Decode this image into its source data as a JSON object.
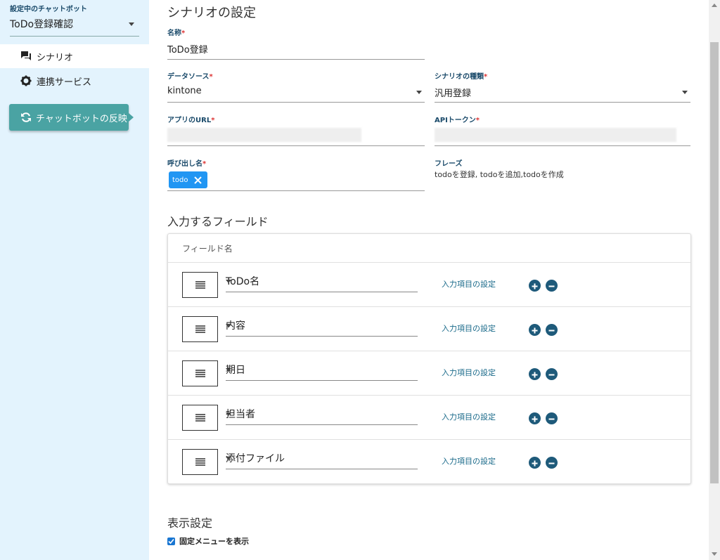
{
  "sidebar": {
    "label": "設定中のチャットボット",
    "selected_bot": "ToDo登録確認",
    "nav": [
      {
        "label": "シナリオ",
        "icon": "chat-icon"
      },
      {
        "label": "連携サービス",
        "icon": "gear-icon"
      }
    ],
    "reflect_button": "チャットボットの反映"
  },
  "main": {
    "title": "シナリオの設定",
    "name": {
      "label": "名称",
      "value": "ToDo登録"
    },
    "datasource": {
      "label": "データソース",
      "value": "kintone"
    },
    "scenario_type": {
      "label": "シナリオの種類",
      "value": "汎用登録"
    },
    "app_url": {
      "label": "アプリのURL"
    },
    "api_token": {
      "label": "APIトークン"
    },
    "call_name": {
      "label": "呼び出し名",
      "chip": "todo"
    },
    "phrase": {
      "label": "フレーズ",
      "value": "todoを登録, todoを追加,todoを作成"
    },
    "required_mark": "*",
    "fields_section": {
      "title": "入力するフィールド",
      "column_header": "フィールド名",
      "link_label": "入力項目の設定",
      "rows": [
        "ToDo名",
        "内容",
        "期日",
        "担当者",
        "添付ファイル"
      ]
    },
    "display_section": {
      "title": "表示設定",
      "checkbox_label": "固定メニューを表示",
      "checked": true
    }
  },
  "colors": {
    "sidebar_bg": "#e3f3fd",
    "accent": "#4aa3a3",
    "chip": "#2196f3",
    "circle_btn": "#1e5a7a"
  }
}
